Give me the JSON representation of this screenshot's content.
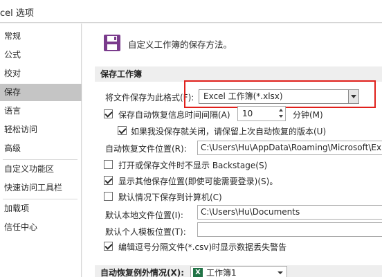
{
  "window": {
    "title": "cel 选项"
  },
  "sidebar": {
    "items": [
      {
        "label": "常规"
      },
      {
        "label": "公式"
      },
      {
        "label": "校对"
      },
      {
        "label": "保存"
      },
      {
        "label": "语言"
      },
      {
        "label": "轻松访问"
      },
      {
        "label": "高级"
      },
      {
        "label": "自定义功能区"
      },
      {
        "label": "快速访问工具栏"
      },
      {
        "label": "加载项"
      },
      {
        "label": "信任中心"
      }
    ],
    "active": "保存"
  },
  "main": {
    "heading": "自定义工作簿的保存方法。",
    "section_save": "保存工作簿",
    "format_label": "将文件保存为此格式(F):",
    "format_value": "Excel 工作簿(*.xlsx)",
    "autorecover_label": "保存自动恢复信息时间间隔(A)",
    "autorecover_checked": true,
    "autorecover_minutes": "10",
    "minutes_label": "分钟(M)",
    "keep_last_label": "如果我没保存就关闭，请保留上次自动恢复的版本(U)",
    "keep_last_checked": true,
    "autorecover_location_label": "自动恢复文件位置(R):",
    "autorecover_location_value": "C:\\Users\\Hu\\AppData\\Roaming\\Microsoft\\Ex",
    "no_backstage_label": "打开或保存文件时不显示 Backstage(S)",
    "no_backstage_checked": false,
    "show_other_label": "显示其他保存位置(即使可能需要登录)(S)。",
    "show_other_checked": true,
    "save_to_computer_label": "默认情况下保存到计算机(C)",
    "save_to_computer_checked": false,
    "local_location_label": "默认本地文件位置(I):",
    "local_location_value": "C:\\Users\\Hu\\Documents",
    "template_location_label": "默认个人模板位置(T):",
    "template_location_value": "",
    "csv_warning_label": "编辑逗号分隔文件(*.csv)时显示数据丢失警告",
    "csv_warning_checked": true,
    "section_exceptions": "自动恢复例外情况(X):",
    "exceptions_value": "工作簿1",
    "exceptions_icon": "X"
  }
}
